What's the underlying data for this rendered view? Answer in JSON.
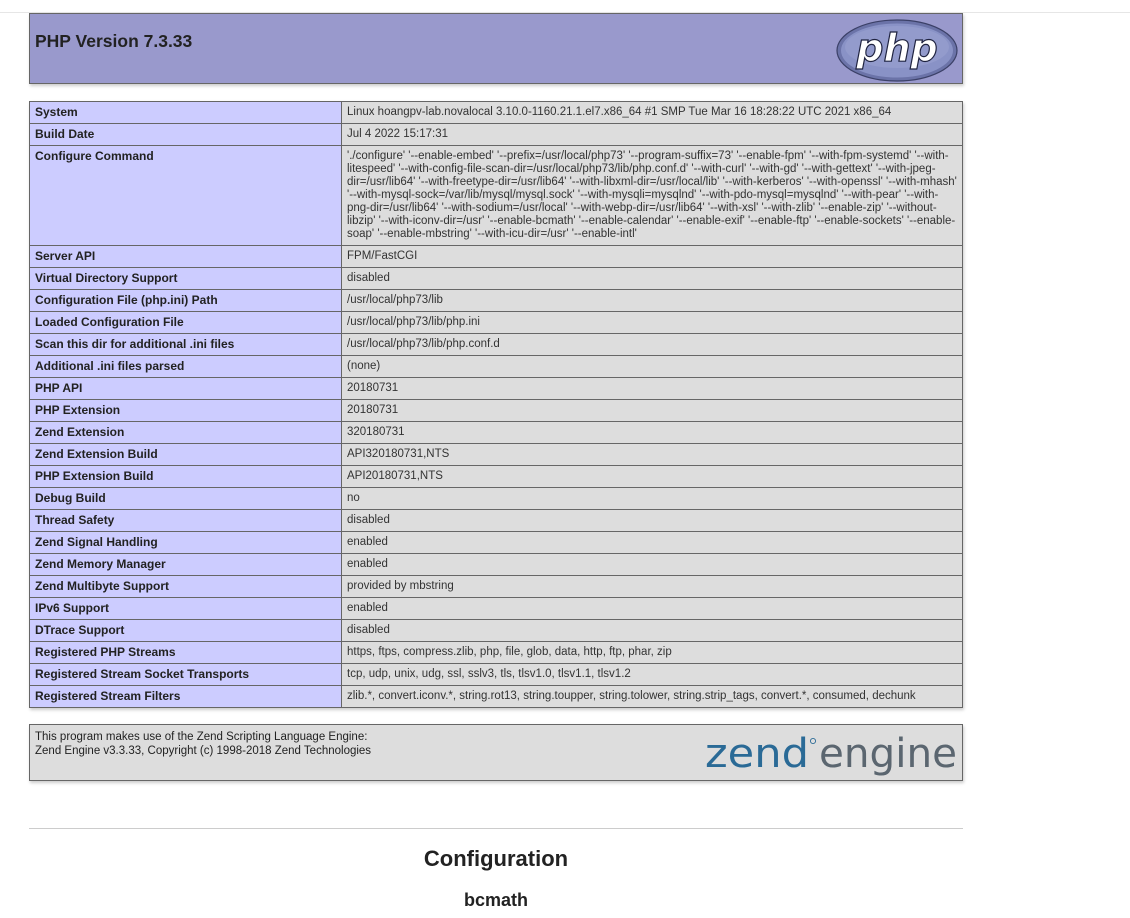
{
  "header": {
    "title": "PHP Version 7.3.33",
    "logo_text": "php"
  },
  "rows": [
    {
      "key": "System",
      "value": "Linux hoangpv-lab.novalocal 3.10.0-1160.21.1.el7.x86_64 #1 SMP Tue Mar 16 18:28:22 UTC 2021 x86_64"
    },
    {
      "key": "Build Date",
      "value": "Jul 4 2022 15:17:31"
    },
    {
      "key": "Configure Command",
      "value": "'./configure' '--enable-embed' '--prefix=/usr/local/php73' '--program-suffix=73' '--enable-fpm' '--with-fpm-systemd' '--with-litespeed' '--with-config-file-scan-dir=/usr/local/php73/lib/php.conf.d' '--with-curl' '--with-gd' '--with-gettext' '--with-jpeg-dir=/usr/lib64' '--with-freetype-dir=/usr/lib64' '--with-libxml-dir=/usr/local/lib' '--with-kerberos' '--with-openssl' '--with-mhash' '--with-mysql-sock=/var/lib/mysql/mysql.sock' '--with-mysqli=mysqlnd' '--with-pdo-mysql=mysqlnd' '--with-pear' '--with-png-dir=/usr/lib64' '--with-sodium=/usr/local' '--with-webp-dir=/usr/lib64' '--with-xsl' '--with-zlib' '--enable-zip' '--without-libzip' '--with-iconv-dir=/usr' '--enable-bcmath' '--enable-calendar' '--enable-exif' '--enable-ftp' '--enable-sockets' '--enable-soap' '--enable-mbstring' '--with-icu-dir=/usr' '--enable-intl'"
    },
    {
      "key": "Server API",
      "value": "FPM/FastCGI"
    },
    {
      "key": "Virtual Directory Support",
      "value": "disabled"
    },
    {
      "key": "Configuration File (php.ini) Path",
      "value": "/usr/local/php73/lib"
    },
    {
      "key": "Loaded Configuration File",
      "value": "/usr/local/php73/lib/php.ini"
    },
    {
      "key": "Scan this dir for additional .ini files",
      "value": "/usr/local/php73/lib/php.conf.d"
    },
    {
      "key": "Additional .ini files parsed",
      "value": "(none)"
    },
    {
      "key": "PHP API",
      "value": "20180731"
    },
    {
      "key": "PHP Extension",
      "value": "20180731"
    },
    {
      "key": "Zend Extension",
      "value": "320180731"
    },
    {
      "key": "Zend Extension Build",
      "value": "API320180731,NTS"
    },
    {
      "key": "PHP Extension Build",
      "value": "API20180731,NTS"
    },
    {
      "key": "Debug Build",
      "value": "no"
    },
    {
      "key": "Thread Safety",
      "value": "disabled"
    },
    {
      "key": "Zend Signal Handling",
      "value": "enabled"
    },
    {
      "key": "Zend Memory Manager",
      "value": "enabled"
    },
    {
      "key": "Zend Multibyte Support",
      "value": "provided by mbstring"
    },
    {
      "key": "IPv6 Support",
      "value": "enabled"
    },
    {
      "key": "DTrace Support",
      "value": "disabled"
    },
    {
      "key": "Registered PHP Streams",
      "value": "https, ftps, compress.zlib, php, file, glob, data, http, ftp, phar, zip"
    },
    {
      "key": "Registered Stream Socket Transports",
      "value": "tcp, udp, unix, udg, ssl, sslv3, tls, tlsv1.0, tlsv1.1, tlsv1.2"
    },
    {
      "key": "Registered Stream Filters",
      "value": "zlib.*, convert.iconv.*, string.rot13, string.toupper, string.tolower, string.strip_tags, convert.*, consumed, dechunk"
    }
  ],
  "zend": {
    "line1": "This program makes use of the Zend Scripting Language Engine:",
    "line2": "Zend Engine v3.3.33, Copyright (c) 1998-2018 Zend Technologies",
    "logo_left": "zend",
    "logo_right": "engine"
  },
  "sections": {
    "configuration_heading": "Configuration",
    "first_module": "bcmath"
  },
  "colors": {
    "header_bg": "#9999cc",
    "key_bg": "#ccccff",
    "value_bg": "#dddddd",
    "zend_blue": "#2a6a96",
    "zend_gray": "#5b6670"
  }
}
